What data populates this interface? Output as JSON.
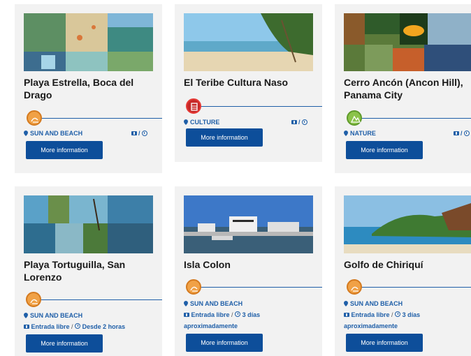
{
  "cards": [
    {
      "title_l1": "Playa Estrella, Boca del",
      "title_l2": "Drago",
      "category": "SUN AND BEACH",
      "button": "More information",
      "sep": "/"
    },
    {
      "title_l1": "El Teribe Cultura Naso",
      "title_l2": "",
      "category": "CULTURE",
      "button": "More information",
      "sep": "/"
    },
    {
      "title_l1": "Cerro Ancón (Ancon Hill),",
      "title_l2": "Panama City",
      "category": "NATURE",
      "button": "More information",
      "sep": "/"
    },
    {
      "title_l1": "Playa Tortuguilla, San",
      "title_l2": "Lorenzo",
      "category": "SUN AND BEACH",
      "button": "More information",
      "entry": "Entrada libre",
      "sep": "/",
      "duration": "Desde 2 horas"
    },
    {
      "title_l1": "Isla Colon",
      "title_l2": "",
      "category": "SUN AND BEACH",
      "button": "More information",
      "entry": "Entrada libre",
      "sep": "/",
      "duration": "3 días",
      "duration_l2": "aproximadamente"
    },
    {
      "title_l1": "Golfo de Chiriquí",
      "title_l2": "",
      "category": "SUN AND BEACH",
      "button": "More information",
      "entry": "Entrada libre",
      "sep": "/",
      "duration": "3 días",
      "duration_l2": "aproximadamente"
    }
  ],
  "icons": {
    "category_beach": "beach-icon",
    "category_culture": "culture-icon",
    "category_nature": "nature-icon",
    "location": "location-pin-icon",
    "ticket": "ticket-icon",
    "clock": "clock-icon"
  },
  "colors": {
    "accent": "#1f5fa8",
    "button": "#0d4e9a",
    "card_bg": "#f2f2f2"
  }
}
